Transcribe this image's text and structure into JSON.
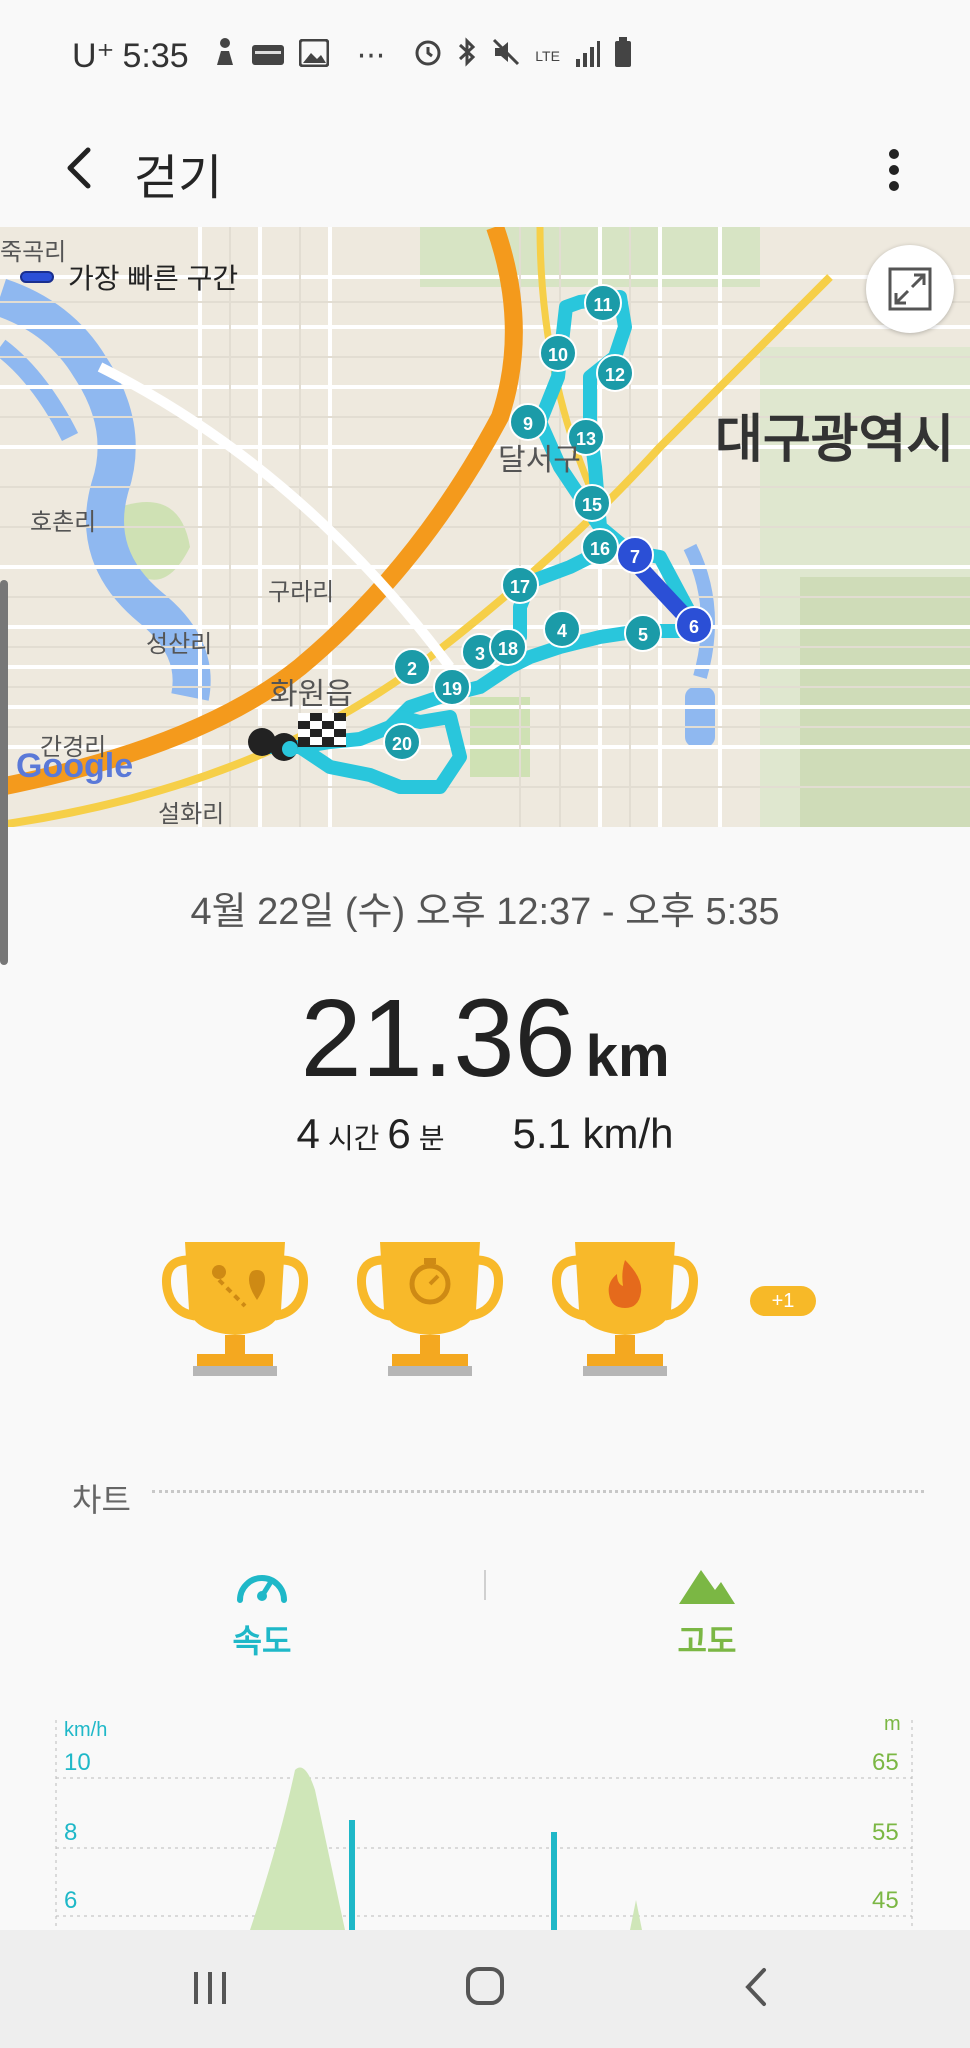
{
  "status_bar": {
    "carrier": "U⁺",
    "time": "5:35",
    "dots": "···",
    "network": "LTE"
  },
  "header": {
    "title": "걷기"
  },
  "map": {
    "legend_label": "가장 빠른 구간",
    "google_logo": "Google",
    "labels": {
      "city": "대구광역시",
      "hochon": "호촌리",
      "gurari": "구라리",
      "seongsan": "성산리",
      "hwawon": "화원읍",
      "gangyeong": "간경리",
      "seolhwa": "설화리",
      "dalseo": "달서구",
      "jukgok": "죽곡리"
    },
    "markers": [
      "2",
      "3",
      "4",
      "5",
      "6",
      "7",
      "9",
      "10",
      "11",
      "12",
      "13",
      "15",
      "16",
      "17",
      "18",
      "19",
      "20"
    ],
    "colors": {
      "route": "#29c6dc",
      "marker": "#1b9ba8",
      "fastest": "#2b4fd6"
    }
  },
  "summary": {
    "datetime": "4월 22일 (수) 오후 12:37 - 오후 5:35",
    "distance": "21.36",
    "distance_unit": "km",
    "hours": "4",
    "hours_unit": "시간",
    "minutes": "6",
    "minutes_unit": "분",
    "speed": "5.1 km/h"
  },
  "trophies": {
    "icons": [
      "route-trophy-icon",
      "timer-trophy-icon",
      "fire-trophy-icon"
    ],
    "extra": "+1"
  },
  "chart_section": {
    "title": "차트",
    "tab_speed": "속도",
    "tab_altitude": "고도",
    "speed_color": "#1fb8c8",
    "altitude_color": "#7bb744"
  },
  "chart_data": {
    "type": "line",
    "left_axis_unit": "km/h",
    "right_axis_unit": "m",
    "left_ticks": [
      "10",
      "8",
      "6"
    ],
    "right_ticks": [
      "65",
      "55",
      "45"
    ]
  }
}
